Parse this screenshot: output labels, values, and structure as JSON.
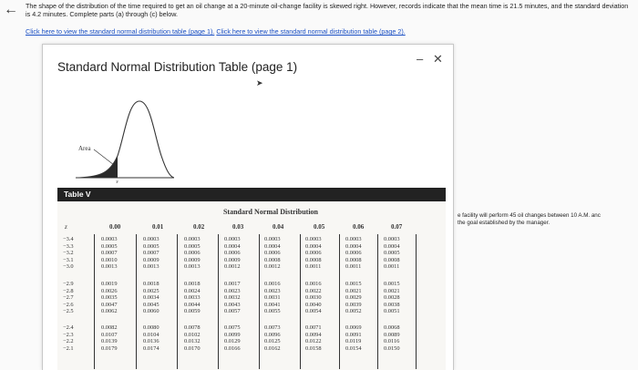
{
  "back_label": "←",
  "problem": {
    "text": "The shape of the distribution of the time required to get an oil change at a 20-minute oil-change facility is skewed right. However, records indicate that the mean time is 21.5 minutes, and the standard deviation is 4.2 minutes. Complete parts (a) through (c) below."
  },
  "links": {
    "table1": "Click here to view the standard normal distribution table (page 1).",
    "table2": "Click here to view the standard normal distribution table (page 2)."
  },
  "side_text": {
    "line1": "e facility will perform 45 oil changes between 10 A.M. anc",
    "line2": "the goal established by the manager."
  },
  "modal": {
    "title": "Standard Normal Distribution Table (page 1)",
    "minimize": "–",
    "close": "✕",
    "figure": {
      "area_label": "Area",
      "z_label": "z"
    },
    "table_label": "Table V",
    "table_title_line1": "Standard Normal Distribution",
    "z_header": "z",
    "col_headers": [
      "0.00",
      "0.01",
      "0.02",
      "0.03",
      "0.04",
      "0.05",
      "0.06",
      "0.07"
    ],
    "groups": [
      {
        "z": [
          "−3.4",
          "−3.3",
          "−3.2",
          "−3.1",
          "−3.0"
        ],
        "cols": [
          [
            "0.0003",
            "0.0005",
            "0.0007",
            "0.0010",
            "0.0013"
          ],
          [
            "0.0003",
            "0.0005",
            "0.0007",
            "0.0009",
            "0.0013"
          ],
          [
            "0.0003",
            "0.0005",
            "0.0006",
            "0.0009",
            "0.0013"
          ],
          [
            "0.0003",
            "0.0004",
            "0.0006",
            "0.0009",
            "0.0012"
          ],
          [
            "0.0003",
            "0.0004",
            "0.0006",
            "0.0008",
            "0.0012"
          ],
          [
            "0.0003",
            "0.0004",
            "0.0006",
            "0.0008",
            "0.0011"
          ],
          [
            "0.0003",
            "0.0004",
            "0.0006",
            "0.0008",
            "0.0011"
          ],
          [
            "0.0003",
            "0.0004",
            "0.0005",
            "0.0008",
            "0.0011"
          ]
        ]
      },
      {
        "z": [
          "−2.9",
          "−2.8",
          "−2.7",
          "−2.6",
          "−2.5"
        ],
        "cols": [
          [
            "0.0019",
            "0.0026",
            "0.0035",
            "0.0047",
            "0.0062"
          ],
          [
            "0.0018",
            "0.0025",
            "0.0034",
            "0.0045",
            "0.0060"
          ],
          [
            "0.0018",
            "0.0024",
            "0.0033",
            "0.0044",
            "0.0059"
          ],
          [
            "0.0017",
            "0.0023",
            "0.0032",
            "0.0043",
            "0.0057"
          ],
          [
            "0.0016",
            "0.0023",
            "0.0031",
            "0.0041",
            "0.0055"
          ],
          [
            "0.0016",
            "0.0022",
            "0.0030",
            "0.0040",
            "0.0054"
          ],
          [
            "0.0015",
            "0.0021",
            "0.0029",
            "0.0039",
            "0.0052"
          ],
          [
            "0.0015",
            "0.0021",
            "0.0028",
            "0.0038",
            "0.0051"
          ]
        ]
      },
      {
        "z": [
          "−2.4",
          "−2.3",
          "−2.2",
          "−2.1"
        ],
        "cols": [
          [
            "0.0082",
            "0.0107",
            "0.0139",
            "0.0179"
          ],
          [
            "0.0080",
            "0.0104",
            "0.0136",
            "0.0174"
          ],
          [
            "0.0078",
            "0.0102",
            "0.0132",
            "0.0170"
          ],
          [
            "0.0075",
            "0.0099",
            "0.0129",
            "0.0166"
          ],
          [
            "0.0073",
            "0.0096",
            "0.0125",
            "0.0162"
          ],
          [
            "0.0071",
            "0.0094",
            "0.0122",
            "0.0158"
          ],
          [
            "0.0069",
            "0.0091",
            "0.0119",
            "0.0154"
          ],
          [
            "0.0068",
            "0.0089",
            "0.0116",
            "0.0150"
          ]
        ]
      }
    ]
  }
}
